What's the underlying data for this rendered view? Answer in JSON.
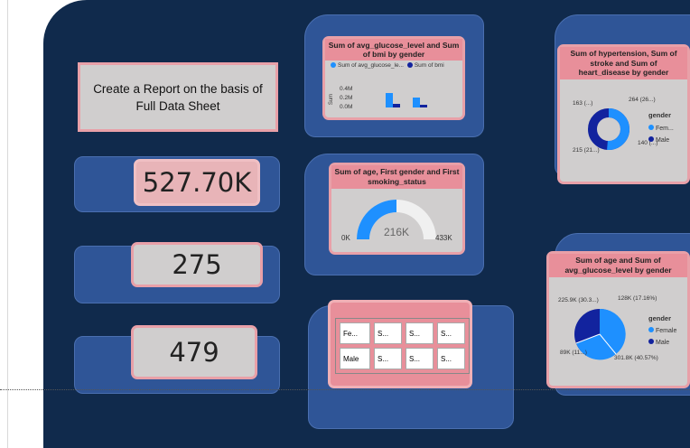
{
  "report_card": {
    "text": "Create a Report on the basis of Full Data Sheet"
  },
  "kpis": [
    {
      "value": "527.70K"
    },
    {
      "value": "275"
    },
    {
      "value": "479"
    }
  ],
  "bar_chart": {
    "title": "Sum of avg_glucose_level and Sum of bmi by gender",
    "legend": [
      "Sum of avg_glucose_le...",
      "Sum of bmi"
    ],
    "ylabel": "Sum",
    "ticks": [
      "0.4M",
      "0.2M",
      "0.0M"
    ]
  },
  "gauge": {
    "title": "Sum of age, First gender and First smoking_status",
    "min_label": "0K",
    "value_label": "216K",
    "max_label": "433K",
    "value": 216,
    "max": 433
  },
  "matrix": {
    "rows": [
      {
        "label": "Fe...",
        "cells": [
          "S...",
          "S...",
          "S..."
        ]
      },
      {
        "label": "Male",
        "cells": [
          "S...",
          "S...",
          "S..."
        ]
      }
    ]
  },
  "donut": {
    "title": "Sum of hypertension, Sum of stroke and Sum of heart_disease by gender",
    "labels": [
      "163 (...)",
      "264 (26...)",
      "140 (...)",
      "215 (21...)"
    ],
    "legend_title": "gender",
    "legend": [
      "Fem...",
      "Male"
    ]
  },
  "pie": {
    "title": "Sum of age and Sum of avg_glucose_level by gender",
    "labels": [
      "225.9K (30.3...)",
      "128K (17.16%)",
      "89K (11...)",
      "301.8K (40.57%)"
    ],
    "legend_title": "gender",
    "legend": [
      "Female",
      "Male"
    ]
  },
  "colors": {
    "female": "#1e90ff",
    "male": "#12239e",
    "accent": "#e88f9a",
    "background": "#102a4c"
  }
}
